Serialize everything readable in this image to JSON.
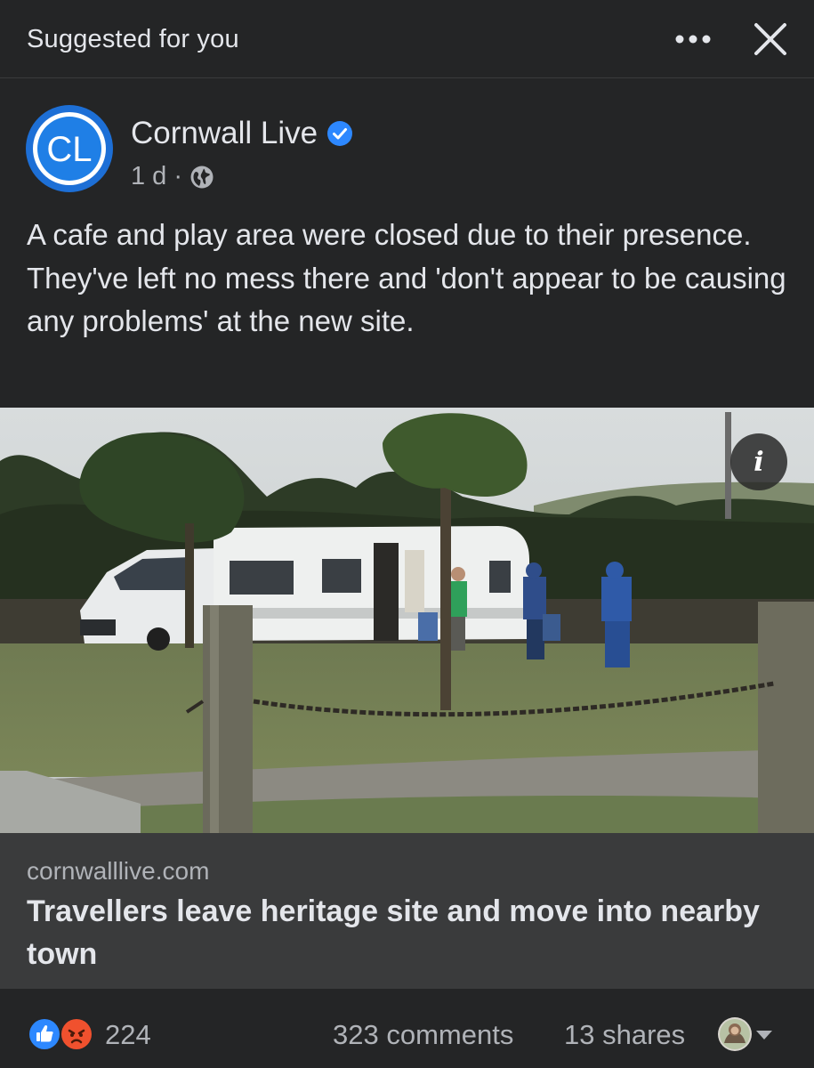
{
  "header": {
    "label": "Suggested for you",
    "more_icon": "more-horizontal-icon",
    "close_icon": "close-icon"
  },
  "post": {
    "page_name": "Cornwall Live",
    "avatar_initials": "CL",
    "verified_icon": "verified-badge-icon",
    "time": "1 d",
    "separator": "·",
    "audience_icon": "globe-icon",
    "text_line1": "A cafe and play area were closed due to their presence.",
    "text_line2": "They've left no mess there and 'don't appear to be causing any problems' at the new site."
  },
  "link": {
    "domain": "cornwalllive.com",
    "title": "Travellers leave heritage site and move into nearby town",
    "info_icon": "info-icon"
  },
  "footer": {
    "reaction_count": "224",
    "comments": "323 comments",
    "shares": "13 shares"
  },
  "colors": {
    "background": "#242526",
    "link_box": "#3a3b3c",
    "accent_blue": "#2d88ff",
    "text_primary": "#e4e6eb",
    "text_secondary": "#b0b3b8"
  }
}
